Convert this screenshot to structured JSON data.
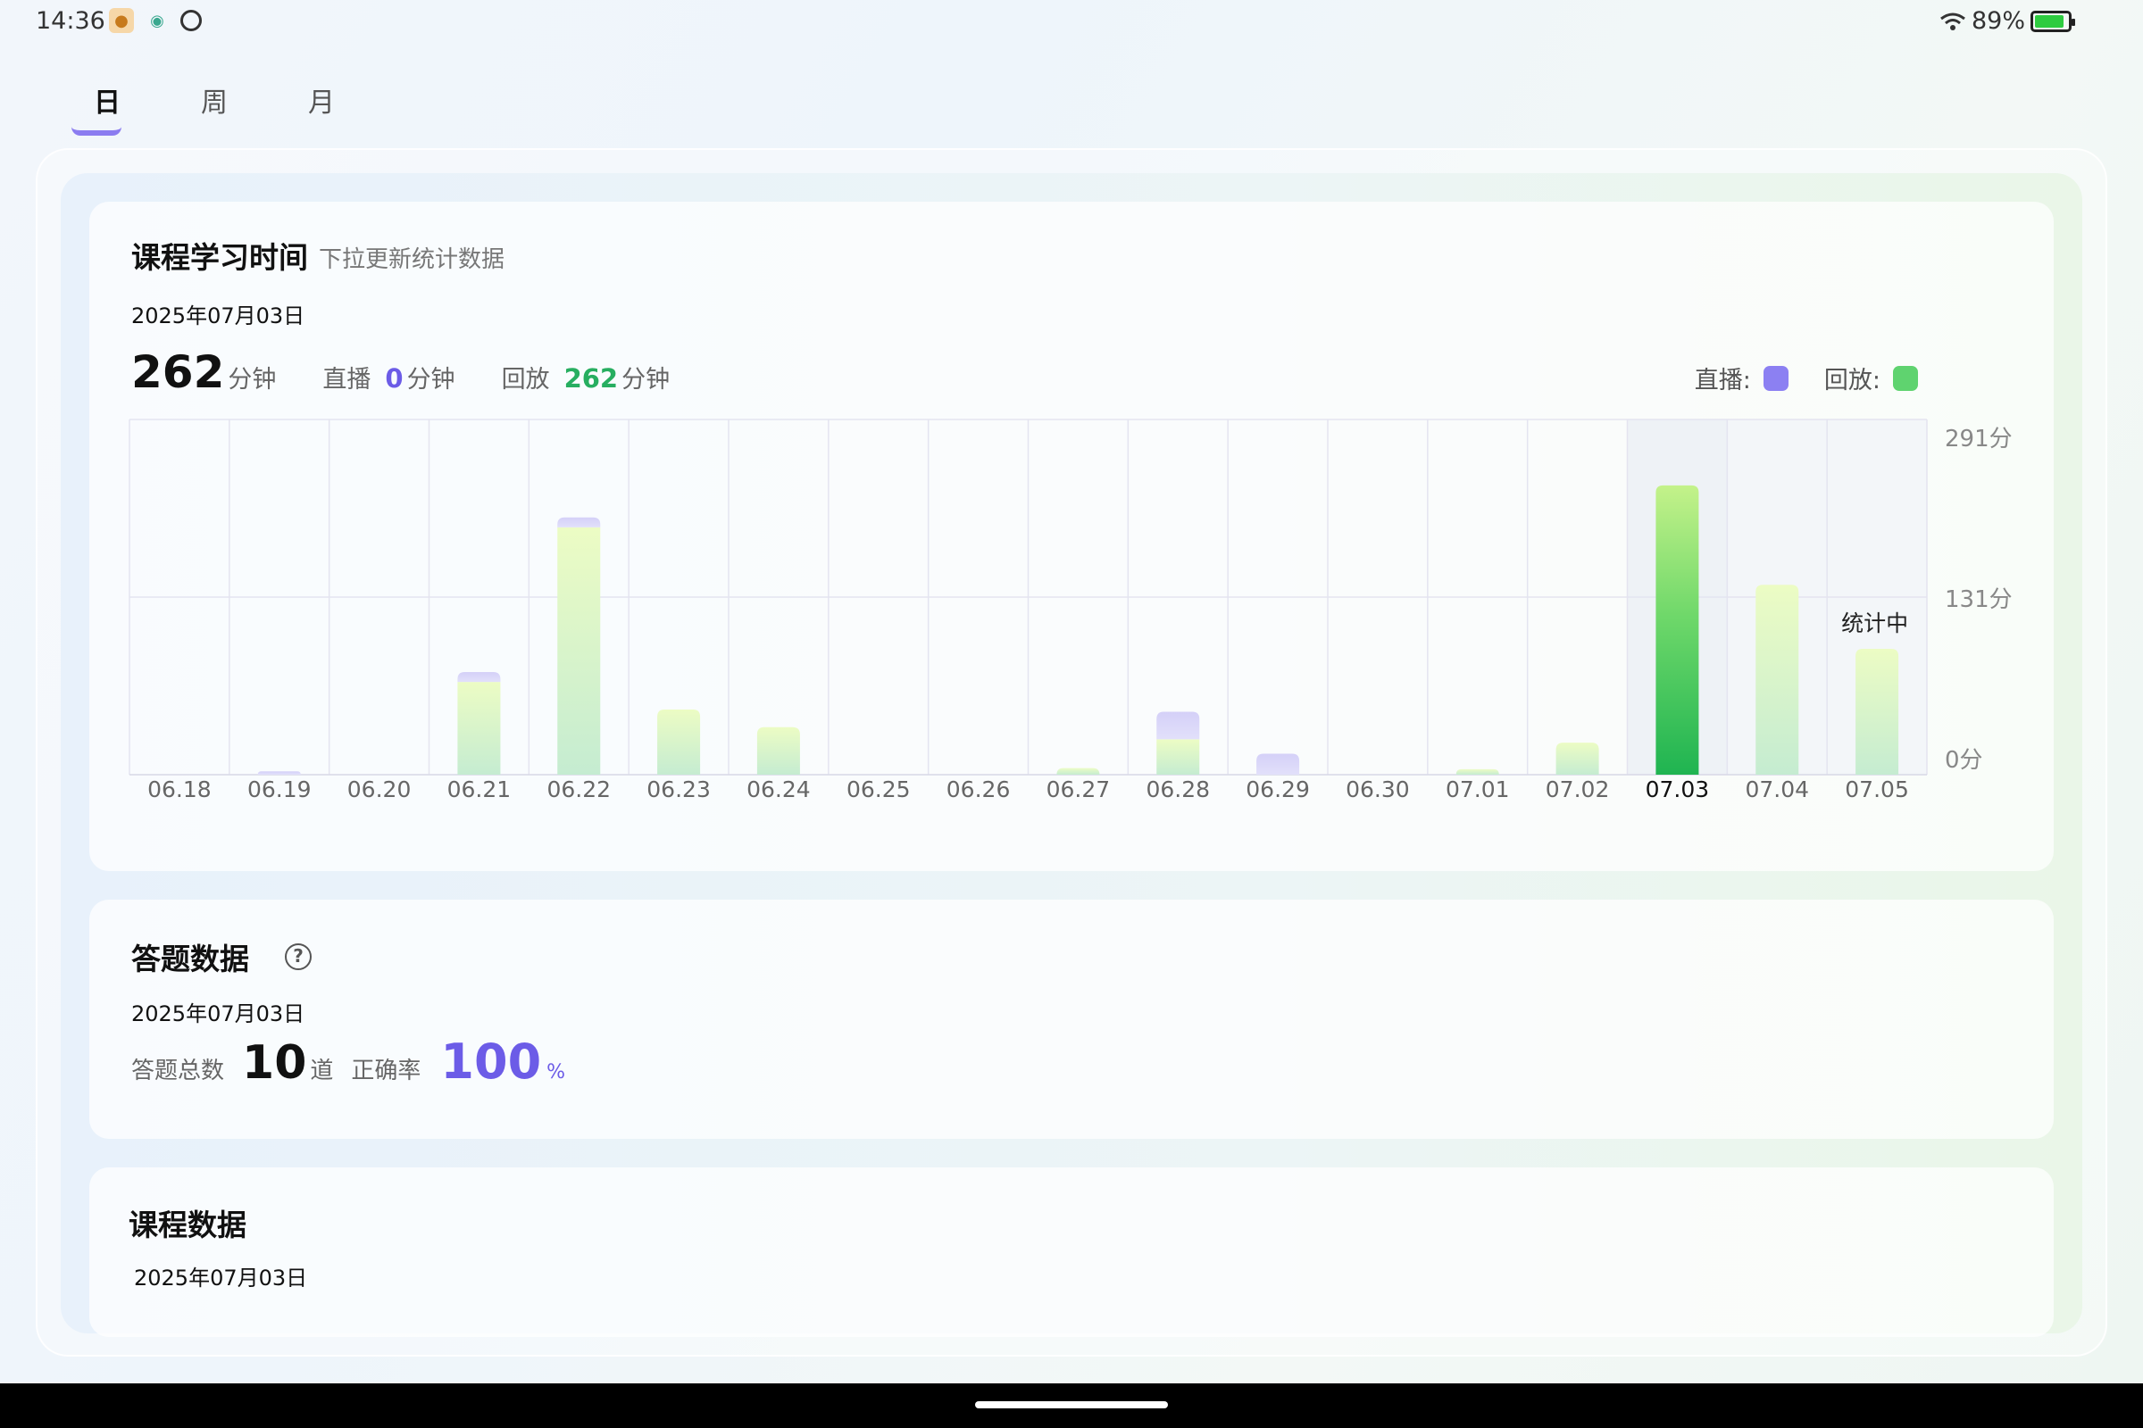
{
  "status_bar": {
    "time": "14:36",
    "battery": "89%",
    "battery_level": 0.89,
    "icons": [
      "app-notification-icon",
      "app-notification-icon",
      "timer-icon",
      "wifi-icon",
      "battery-icon"
    ]
  },
  "tabs": [
    {
      "label": "日",
      "active": true
    },
    {
      "label": "周",
      "active": false
    },
    {
      "label": "月",
      "active": false
    }
  ],
  "study_time": {
    "title": "课程学习时间",
    "subtitle": "下拉更新统计数据",
    "date": "2025年07月03日",
    "total": "262",
    "total_unit": "分钟",
    "live_label": "直播",
    "live_value": "0",
    "live_unit": "分钟",
    "replay_label": "回放",
    "replay_value": "262",
    "replay_unit": "分钟",
    "legend_live": "直播:",
    "legend_replay": "回放:",
    "counting_label": "统计中"
  },
  "chart_data": {
    "type": "bar",
    "stacked": true,
    "categories": [
      "06.18",
      "06.19",
      "06.20",
      "06.21",
      "06.22",
      "06.23",
      "06.24",
      "06.25",
      "06.26",
      "06.27",
      "06.28",
      "06.29",
      "06.30",
      "07.01",
      "07.02",
      "07.03",
      "07.04",
      "07.05"
    ],
    "series": [
      {
        "name": "回放",
        "color": "#5fd36f",
        "values": [
          0,
          0,
          0,
          84,
          224,
          59,
          43,
          0,
          0,
          6,
          32,
          0,
          0,
          5,
          29,
          262,
          172,
          114
        ]
      },
      {
        "name": "直播",
        "color": "#8c80f2",
        "values": [
          0,
          3,
          0,
          9,
          9,
          0,
          0,
          0,
          0,
          0,
          25,
          19,
          0,
          0,
          0,
          0,
          0,
          0
        ]
      }
    ],
    "y_tick_labels": [
      "0分",
      "131分",
      "291分"
    ],
    "ylim": [
      0,
      291
    ],
    "selected": "07.03",
    "in_progress": "07.05",
    "grid": true
  },
  "quiz": {
    "title": "答题数据",
    "date": "2025年07月03日",
    "total_label": "答题总数",
    "total": "10",
    "total_unit": "道",
    "accuracy_label": "正确率",
    "accuracy": "100",
    "accuracy_unit": "%"
  },
  "course": {
    "title": "课程数据",
    "date": "2025年07月03日"
  }
}
